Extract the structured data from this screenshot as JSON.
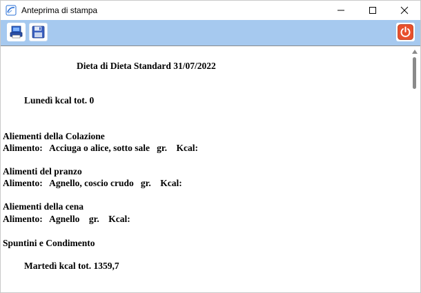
{
  "window": {
    "title": "Anteprima di stampa",
    "minimize": "—",
    "maximize": "☐",
    "close": "✕"
  },
  "toolbar": {
    "print_icon": "printer-icon",
    "save_icon": "floppy-disk-icon",
    "exit_icon": "power-icon",
    "colors": {
      "background": "#a6c9ef",
      "exit": "#e8502c"
    }
  },
  "document": {
    "title": "Dieta di Dieta Standard 31/07/2022",
    "day1": "Lunedì kcal tot. 0",
    "colazione_header": "Aliementi della Colazione",
    "colazione_item": "Alimento:   Acciuga o alice, sotto sale   gr.    Kcal:",
    "pranzo_header": "Alimenti del pranzo",
    "pranzo_item": "Alimento:   Agnello, coscio crudo   gr.    Kcal:",
    "cena_header": "Aliementi della cena",
    "cena_item": "Alimento:   Agnello    gr.    Kcal:",
    "spuntini_header": "Spuntini e Condimento",
    "day2": "Martedì kcal tot. 1359,7"
  }
}
